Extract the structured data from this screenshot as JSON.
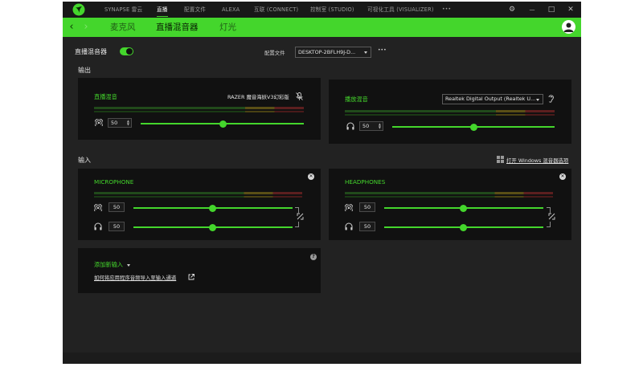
{
  "titlebar": {
    "nav": [
      "SYNAPSE 雷云",
      "直播",
      "配置文件",
      "ALEXA",
      "互联 (CONNECT)",
      "控制室 (STUDIO)",
      "可视化工具 (VISUALIZER)"
    ],
    "more": "•••",
    "controls": {
      "settings": "⚙",
      "minimize": "—",
      "maximize": "□",
      "close": "✕"
    }
  },
  "subbar": {
    "back": "‹",
    "forward": "›",
    "tabs": [
      "麦克风",
      "直播混音器",
      "灯光"
    ],
    "active_tab": "直播混音器"
  },
  "header": {
    "mixer_label": "直播混音器",
    "toggle_on": true,
    "profile_label": "配置文件",
    "profile_value": "DESKTOP-2BFLH9J-D...",
    "more": "•••"
  },
  "output": {
    "section_title": "输出",
    "stream_mix": {
      "title": "直播混音",
      "device": "RAZER 魔音海妖V3幻彩版",
      "level_value": "50",
      "level": 0.5
    },
    "playback_mix": {
      "title": "播放混音",
      "device": "Realtek Digital Output (Realtek U...",
      "level_value": "50",
      "level": 0.5
    }
  },
  "input": {
    "section_title": "输入",
    "windows_link": "打开 Windows 混音器选项",
    "cards": [
      {
        "title": "MICROPHONE",
        "stream_value": "50",
        "monitor_value": "50",
        "stream_level": 0.5,
        "monitor_level": 0.5
      },
      {
        "title": "HEADPHONES",
        "stream_value": "50",
        "monitor_value": "50",
        "stream_level": 0.5,
        "monitor_level": 0.5
      }
    ],
    "add": {
      "label": "添加新输入",
      "help_link": "如何将应用程序音频导入至输入通道",
      "info": "?"
    },
    "close": "✕"
  },
  "colors": {
    "accent": "#44d62c",
    "background": "#222222",
    "card": "#111111"
  }
}
